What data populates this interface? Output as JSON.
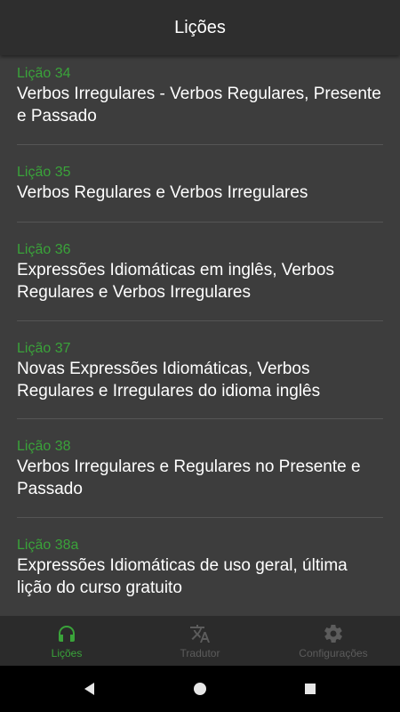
{
  "header": {
    "title": "Lições"
  },
  "lessons": [
    {
      "number": "Lição 34",
      "title": "Verbos Irregulares - Verbos Regulares, Presente e Passado"
    },
    {
      "number": "Lição 35",
      "title": "Verbos Regulares e Verbos Irregulares"
    },
    {
      "number": "Lição 36",
      "title": "Expressões Idiomáticas em inglês, Verbos Regulares e Verbos Irregulares"
    },
    {
      "number": "Lição 37",
      "title": "Novas Expressões Idiomáticas, Verbos Regulares e Irregulares do idioma inglês"
    },
    {
      "number": "Lição 38",
      "title": "Verbos Irregulares e Regulares no Presente e Passado"
    },
    {
      "number": "Lição 38a",
      "title": "Expressões Idiomáticas de uso geral, última lição do curso gratuito"
    }
  ],
  "bottom_nav": {
    "lessons_label": "Lições",
    "translator_label": "Tradutor",
    "settings_label": "Configurações",
    "active": "lessons"
  },
  "colors": {
    "accent_green": "#3aa33a",
    "background": "#3d3d3d",
    "app_bar": "#2e2e2e",
    "nav_inactive": "#5c5c5c"
  },
  "icons": {
    "lessons": "headphones-icon",
    "translator": "translate-icon",
    "settings": "gear-icon",
    "back": "back-triangle-icon",
    "home": "home-circle-icon",
    "recents": "recents-square-icon"
  }
}
